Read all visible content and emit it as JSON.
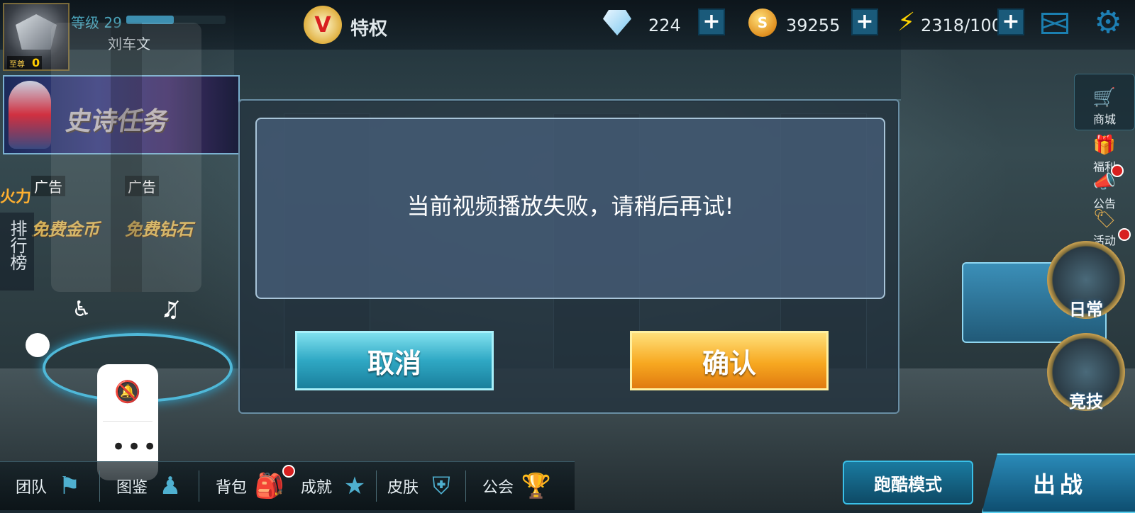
{
  "player": {
    "level_label": "等级",
    "level": "29",
    "level_progress": 0.48,
    "name": "刘车文",
    "vip_label": "至尊",
    "vip_level": "0"
  },
  "header": {
    "privilege_label": "特权",
    "gems": "224",
    "coins": "39255",
    "energy": "2318/100",
    "plus_symbol": "+"
  },
  "left_panel": {
    "epic_quest": "史诗任务",
    "fire_tag": "火力",
    "ads": [
      {
        "tag": "广告",
        "text": "免费金币"
      },
      {
        "tag": "广告",
        "text": "免费钻石"
      }
    ],
    "ranking": "排行榜"
  },
  "side_menu": {
    "shop": "商城",
    "welfare": "福利",
    "notice": "公告",
    "events": "活动",
    "daily": "日常",
    "arena": "竞技"
  },
  "bottom_bar": {
    "items": [
      "团队",
      "图鉴",
      "背包",
      "成就",
      "皮肤",
      "公会"
    ]
  },
  "actions": {
    "parkour": "跑酷模式",
    "battle": "出战"
  },
  "dialog": {
    "message": "当前视频播放失败，请稍后再试!",
    "cancel": "取消",
    "confirm": "确认"
  },
  "floating_panel": {
    "more": "•••"
  },
  "colors": {
    "cancel_button": "#2fa8c4",
    "confirm_button": "#f7a820",
    "hud_accent": "#1b7fb0"
  }
}
